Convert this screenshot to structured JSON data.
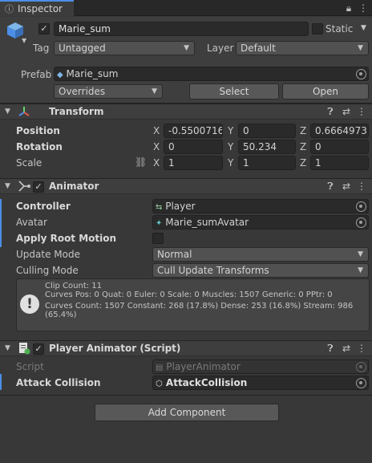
{
  "window": {
    "tab_title": "Inspector"
  },
  "gameobject": {
    "name": "Marie_sum",
    "static_label": "Static",
    "tag_label": "Tag",
    "tag_value": "Untagged",
    "layer_label": "Layer",
    "layer_value": "Default",
    "prefab_label": "Prefab",
    "prefab_value": "Marie_sum",
    "overrides_label": "Overrides",
    "select_label": "Select",
    "open_label": "Open"
  },
  "transform": {
    "title": "Transform",
    "position_label": "Position",
    "rotation_label": "Rotation",
    "scale_label": "Scale",
    "axes": [
      "X",
      "Y",
      "Z"
    ],
    "position": [
      "-0.5500716",
      "0",
      "0.6664973"
    ],
    "rotation": [
      "0",
      "50.234",
      "0"
    ],
    "scale": [
      "1",
      "1",
      "1"
    ]
  },
  "animator": {
    "title": "Animator",
    "controller_label": "Controller",
    "controller_value": "Player",
    "avatar_label": "Avatar",
    "avatar_value": "Marie_sumAvatar",
    "apply_root_motion_label": "Apply Root Motion",
    "update_mode_label": "Update Mode",
    "update_mode_value": "Normal",
    "culling_mode_label": "Culling Mode",
    "culling_mode_value": "Cull Update Transforms",
    "info_lines": [
      "Clip Count: 11",
      "Curves Pos: 0 Quat: 0 Euler: 0 Scale: 0 Muscles: 1507 Generic: 0 PPtr: 0",
      "Curves Count: 1507 Constant: 268 (17.8%) Dense: 253 (16.8%) Stream: 986",
      "(65.4%)"
    ]
  },
  "player_animator": {
    "title": "Player Animator (Script)",
    "script_label": "Script",
    "script_value": "PlayerAnimator",
    "attack_label": "Attack Collision",
    "attack_value": "AttackCollision"
  },
  "add_component_label": "Add Component",
  "colors": {
    "accent": "#4d8ee6",
    "background": "#383838",
    "field": "#2a2a2a"
  }
}
